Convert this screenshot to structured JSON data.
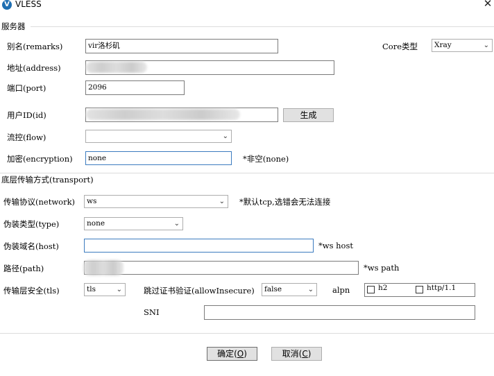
{
  "window": {
    "title": "VLESS",
    "icon_letter": "V"
  },
  "server_section": {
    "title": "服务器",
    "remarks": {
      "label": "别名(remarks)",
      "value": "vir洛杉矶"
    },
    "core_type": {
      "label": "Core类型",
      "value": "Xray"
    },
    "address": {
      "label": "地址(address)"
    },
    "port": {
      "label": "端口(port)",
      "value": "2096"
    },
    "user_id": {
      "label": "用户ID(id)",
      "generate_label": "生成"
    },
    "flow": {
      "label": "流控(flow)",
      "value": ""
    },
    "encryption": {
      "label": "加密(encryption)",
      "value": "none",
      "hint": "*非空(none)"
    }
  },
  "transport_section": {
    "title": "底层传输方式(transport)",
    "network": {
      "label": "传输协议(network)",
      "value": "ws",
      "hint": "*默认tcp,选错会无法连接"
    },
    "type": {
      "label": "伪装类型(type)",
      "value": "none"
    },
    "host": {
      "label": "伪装域名(host)",
      "value": "",
      "hint": "*ws host"
    },
    "path": {
      "label": "路径(path)",
      "hint": "*ws path"
    },
    "tls": {
      "label": "传输层安全(tls)",
      "value": "tls"
    },
    "allow_insecure": {
      "label": "跳过证书验证(allowInsecure)",
      "value": "false"
    },
    "alpn": {
      "label": "alpn",
      "options": [
        "h2",
        "http/1.1"
      ]
    },
    "sni": {
      "label": "SNI",
      "value": ""
    }
  },
  "footer": {
    "ok_label": "确定",
    "ok_shortcut": "O",
    "cancel_label": "取消",
    "cancel_shortcut": "C"
  }
}
